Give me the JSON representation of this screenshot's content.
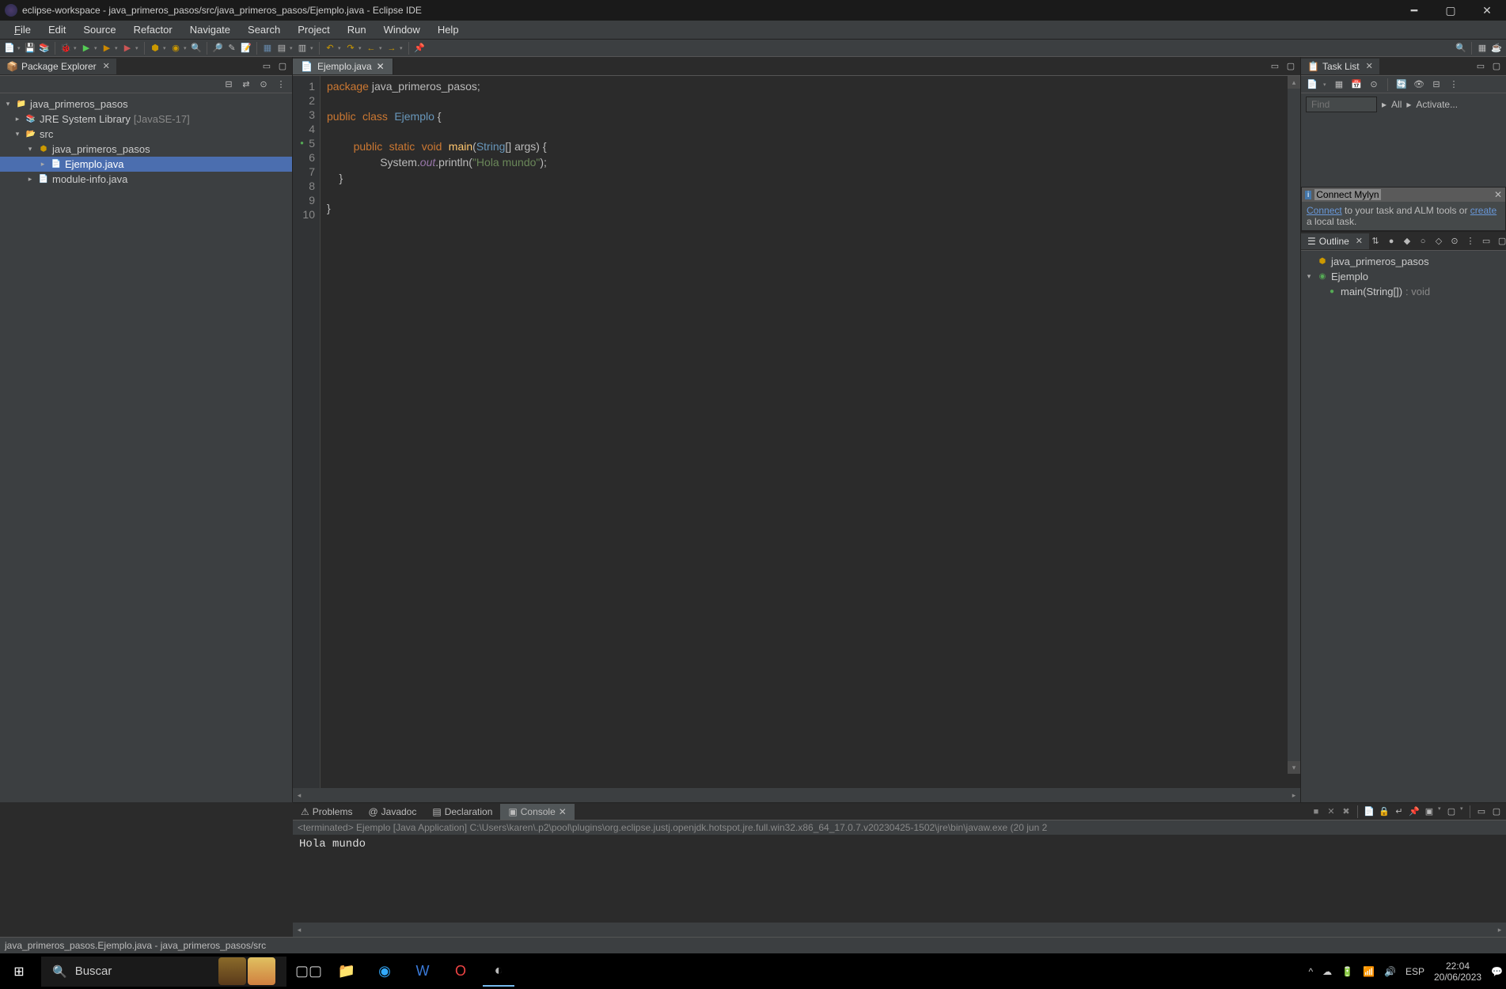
{
  "titlebar": {
    "text": "eclipse-workspace - java_primeros_pasos/src/java_primeros_pasos/Ejemplo.java - Eclipse IDE"
  },
  "menu": {
    "file": "File",
    "edit": "Edit",
    "source": "Source",
    "refactor": "Refactor",
    "navigate": "Navigate",
    "search": "Search",
    "project": "Project",
    "run": "Run",
    "window": "Window",
    "help": "Help"
  },
  "pkgExplorer": {
    "title": "Package Explorer",
    "project": "java_primeros_pasos",
    "jre": "JRE System Library",
    "jreVer": "[JavaSE-17]",
    "src": "src",
    "pkg": "java_primeros_pasos",
    "file1": "Ejemplo.java",
    "file2": "module-info.java"
  },
  "editor": {
    "tab": "Ejemplo.java",
    "lines": [
      "1",
      "2",
      "3",
      "4",
      "5",
      "6",
      "7",
      "8",
      "9",
      "10"
    ],
    "code": {
      "l1_kw": "package",
      "l1_rest": " java_primeros_pasos;",
      "l3_kw1": "public",
      "l3_kw2": "class",
      "l3_cls": "Ejemplo",
      "l3_end": " {",
      "l5_kw1": "public",
      "l5_kw2": "static",
      "l5_kw3": "void",
      "l5_mth": "main",
      "l5_p1": "(",
      "l5_typ": "String",
      "l5_p2": "[] args) {",
      "l6_sys": "System",
      "l6_d1": ".",
      "l6_out": "out",
      "l6_d2": ".println(",
      "l6_str": "\"Hola mundo\"",
      "l6_end": ");",
      "l7": "    }",
      "l9": "}"
    }
  },
  "taskList": {
    "title": "Task List",
    "findPlaceholder": "Find",
    "all": "All",
    "activate": "Activate...",
    "mylynTitle": "Connect Mylyn",
    "mylynConnect": "Connect",
    "mylynText1": " to your task and ALM tools or ",
    "mylynCreate": "create",
    "mylynText2": " a local task."
  },
  "outline": {
    "title": "Outline",
    "pkg": "java_primeros_pasos",
    "cls": "Ejemplo",
    "method": "main(String[])",
    "ret": " : void"
  },
  "bottom": {
    "problems": "Problems",
    "javadoc": "Javadoc",
    "declaration": "Declaration",
    "console": "Console",
    "consoleHead": "<terminated> Ejemplo [Java Application] C:\\Users\\karen\\.p2\\pool\\plugins\\org.eclipse.justj.openjdk.hotspot.jre.full.win32.x86_64_17.0.7.v20230425-1502\\jre\\bin\\javaw.exe  (20 jun 2",
    "consoleOutput": "Hola mundo"
  },
  "statusbar": {
    "text": "java_primeros_pasos.Ejemplo.java - java_primeros_pasos/src"
  },
  "taskbar": {
    "searchPlaceholder": "Buscar",
    "lang": "ESP",
    "time": "22:04",
    "date": "20/06/2023"
  }
}
